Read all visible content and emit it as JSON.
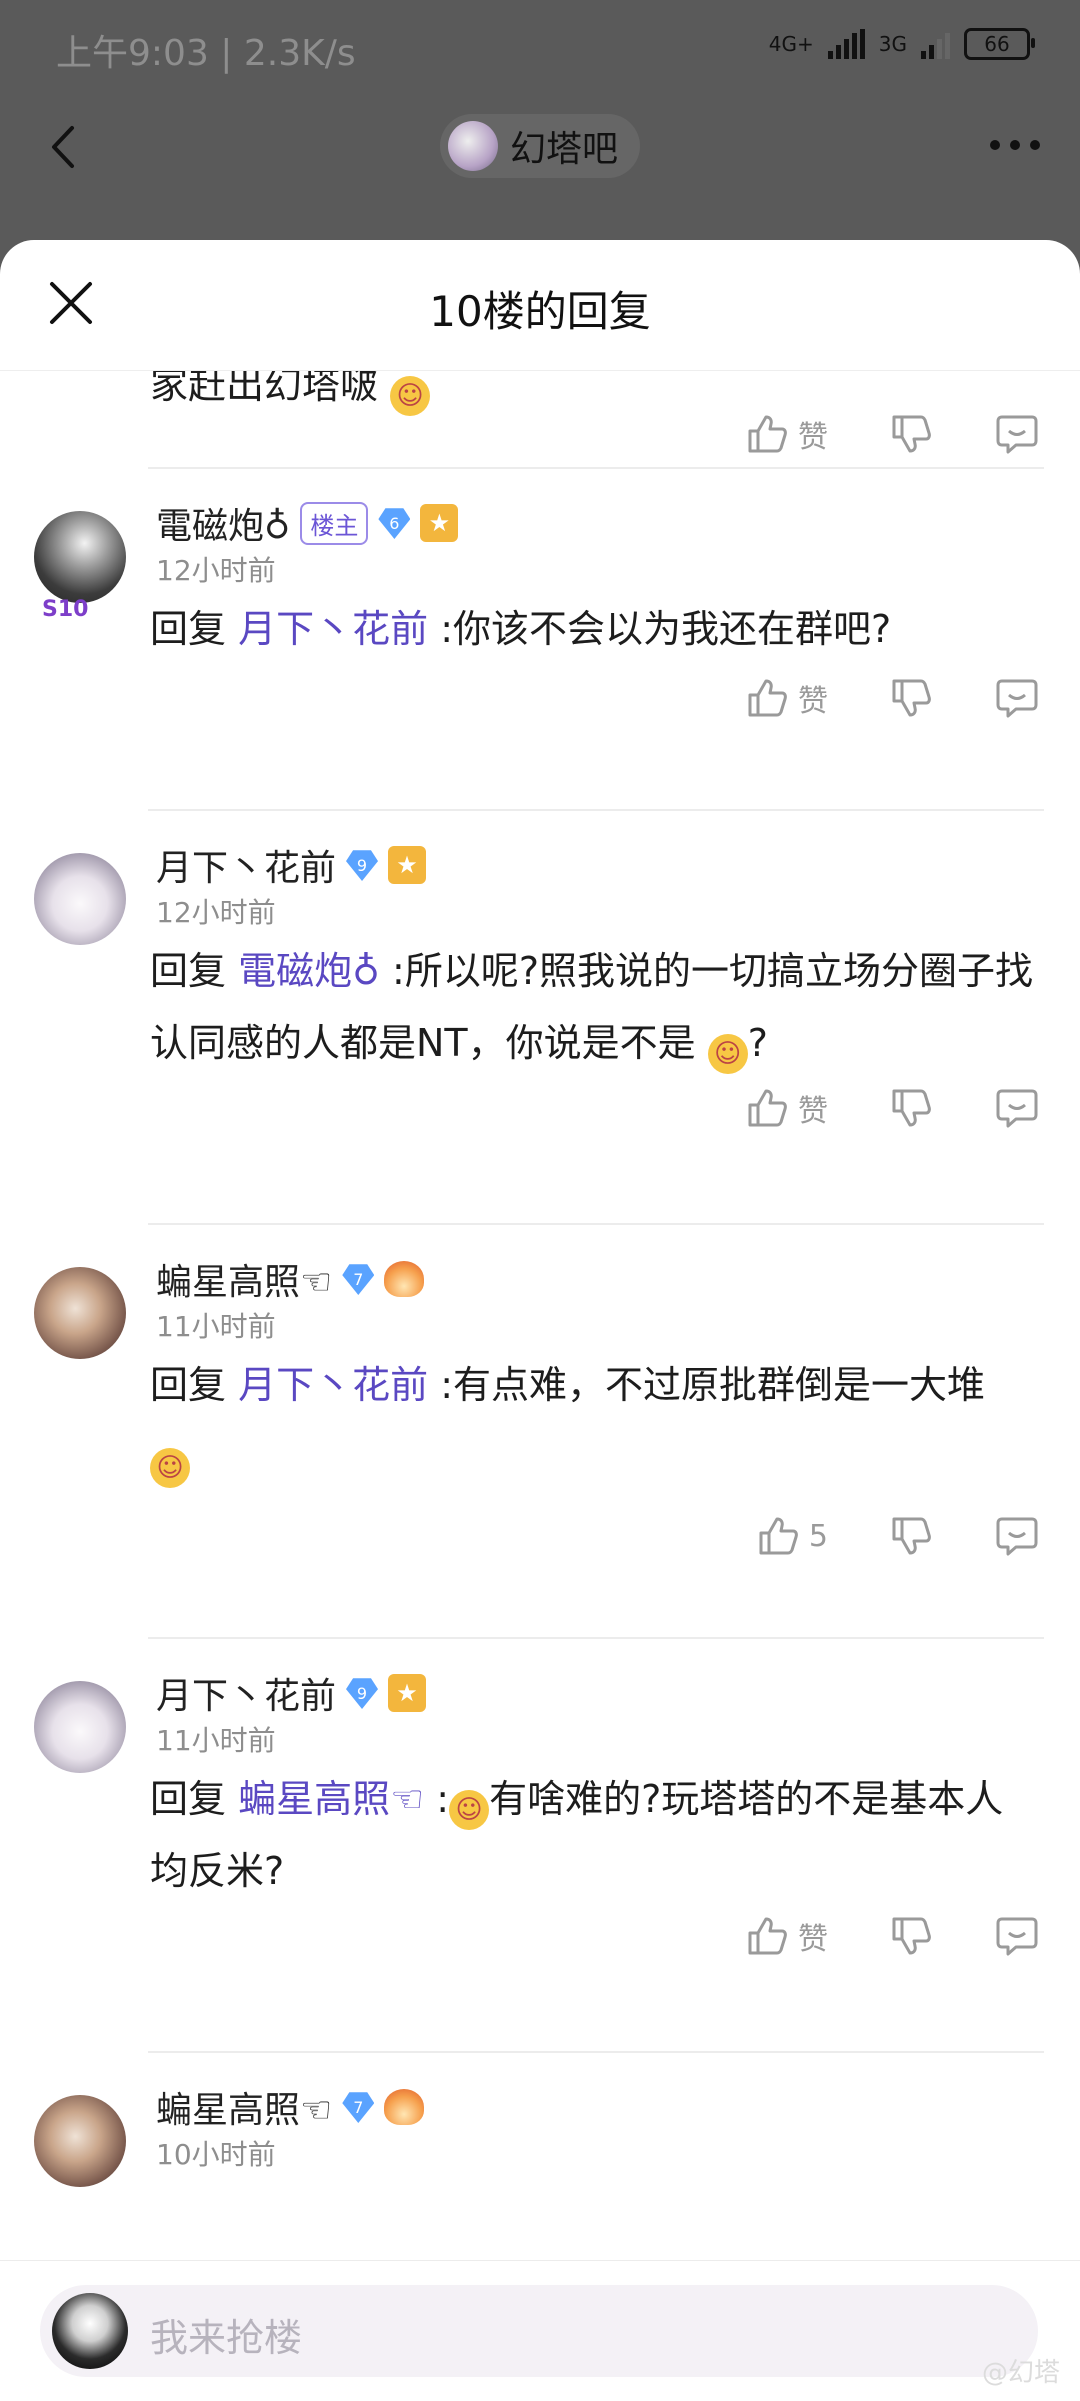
{
  "status_bar": {
    "time": "上午9:03 | 2.3K/s",
    "battery": "66",
    "net1": "4G+",
    "net2": "3G"
  },
  "top_bar": {
    "forum_name": "幻塔吧"
  },
  "sheet": {
    "title": "10楼的回复"
  },
  "partial_top": {
    "text": "家赶出幻塔啵"
  },
  "reply_word": "回复",
  "replies": [
    {
      "user": "電磁炮♁",
      "tag": "楼主",
      "level": "6",
      "time": "12小时前",
      "to": "月下丶花前",
      "text": ":你该不会以为我还在群吧?",
      "like": "赞"
    },
    {
      "user": "月下丶花前",
      "level": "9",
      "time": "12小时前",
      "to": "電磁炮♁",
      "text": ":所以呢?照我说的一切搞立场分圈子找认同感的人都是NT，你说是不是",
      "tail": "?",
      "like": "赞"
    },
    {
      "user": "蝙星高照☜",
      "level": "7",
      "time": "11小时前",
      "to": "月下丶花前",
      "text": ":有点难，不过原批群倒是一大堆",
      "like": "5"
    },
    {
      "user": "月下丶花前",
      "level": "9",
      "time": "11小时前",
      "to": "蝙星高照☜",
      "text_before": ":",
      "text": "有啥难的?玩塔塔的不是基本人均反米?",
      "like": "赞"
    },
    {
      "user": "蝙星高照☜",
      "level": "7",
      "time": "10小时前"
    }
  ],
  "partial_like": "赞",
  "bottom": {
    "placeholder": "我来抢楼"
  },
  "watermark": "@幻塔"
}
